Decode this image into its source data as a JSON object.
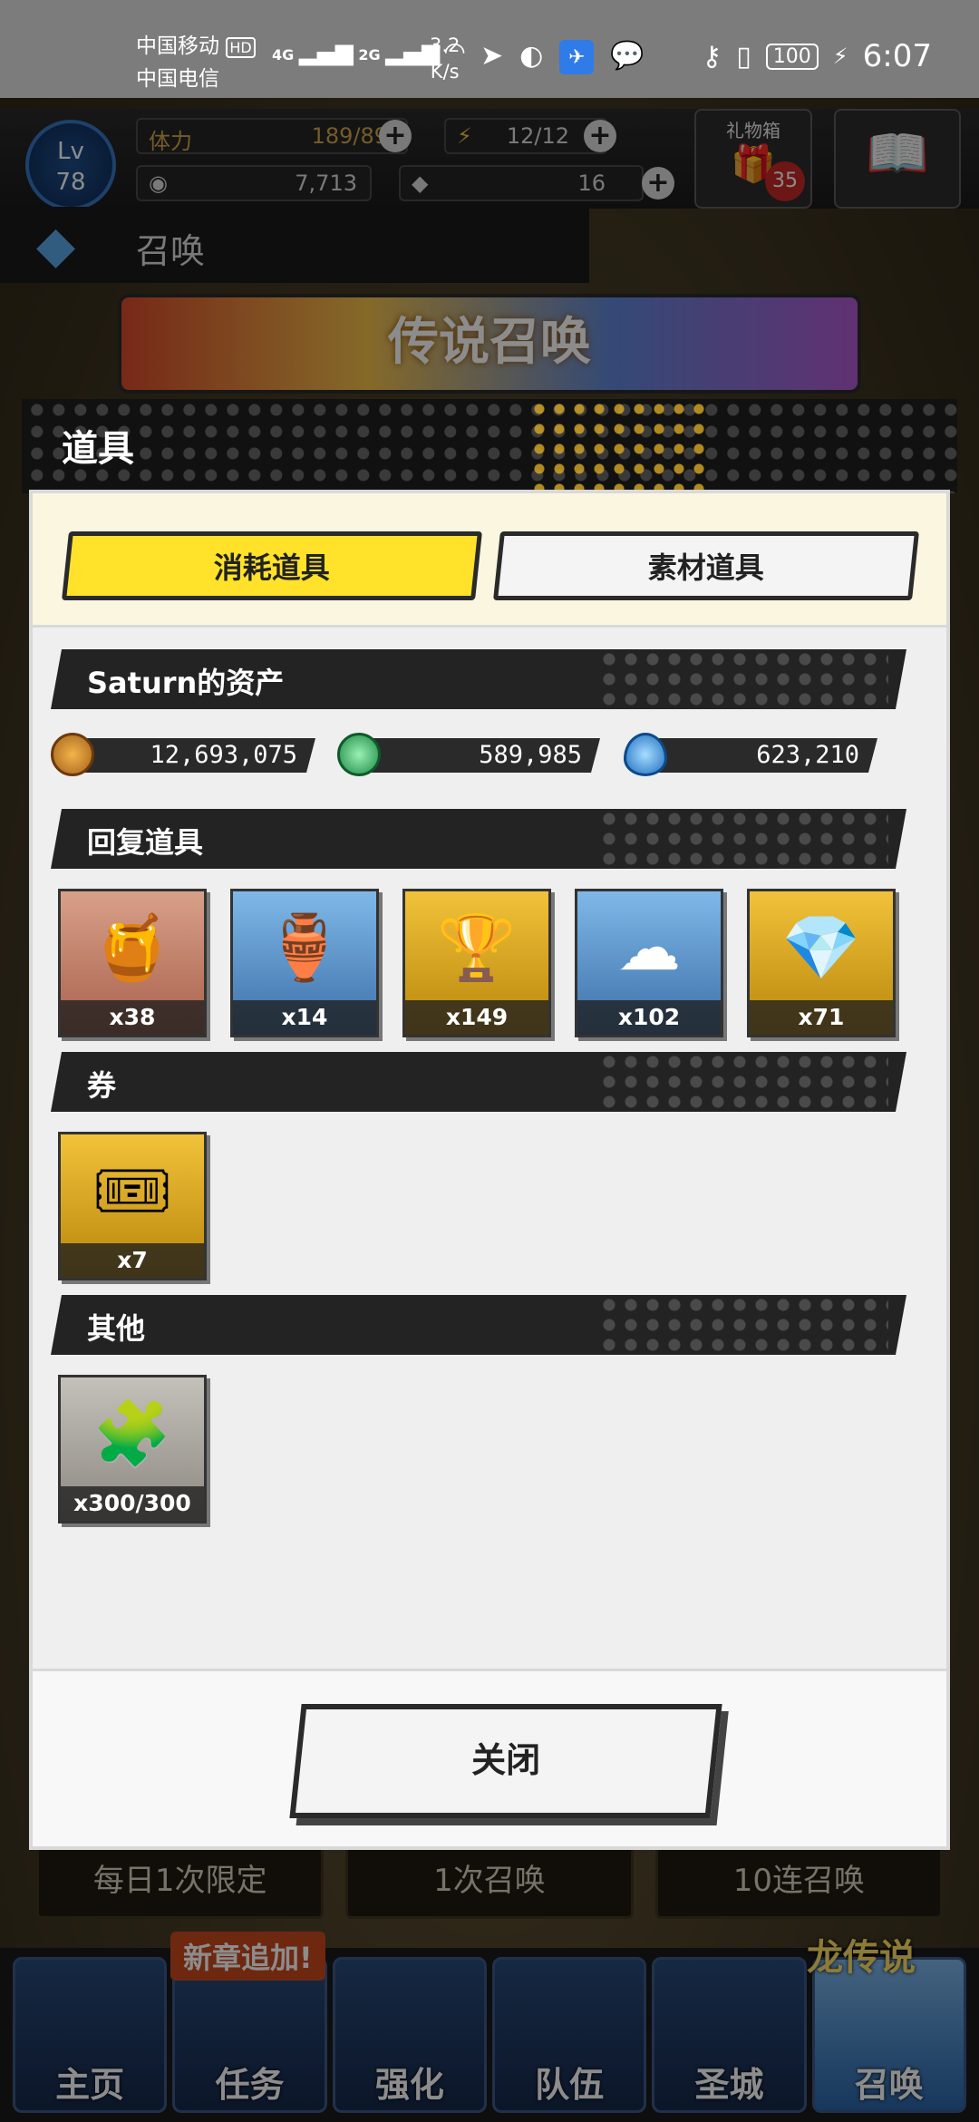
{
  "status_bar": {
    "carrier1": "中国移动",
    "carrier1_badge": "HD",
    "carrier2": "中国电信",
    "net1": "4G",
    "net2": "2G",
    "speed_value": "3.2",
    "speed_unit": "K/s",
    "battery": "100",
    "time": "6:07"
  },
  "game_bg": {
    "level_label": "Lv",
    "level": "78",
    "stamina_label": "体力",
    "stamina": "189/89",
    "energy": "12/12",
    "gems": "7,713",
    "crystals": "16",
    "gift_box_label": "礼物箱",
    "gift_count": "35",
    "summon_title": "召唤",
    "banner_title": "传说召唤",
    "bottom_tabs": [
      "每日1次限定",
      "1次召唤",
      "10连召唤"
    ],
    "new_chapter": "新章追加!",
    "dragon_legend": "龙传说",
    "nav": [
      "主页",
      "任务",
      "强化",
      "队伍",
      "圣城",
      "召唤"
    ]
  },
  "modal": {
    "title": "道具",
    "tabs": {
      "active": "消耗道具",
      "inactive": "素材道具"
    },
    "assets_header": "Saturn的资产",
    "currencies": [
      {
        "icon": "gold-coin-icon",
        "value": "12,693,075",
        "color": "#c87d1e"
      },
      {
        "icon": "green-orb-icon",
        "value": "589,985",
        "color": "#3cb86a"
      },
      {
        "icon": "water-drop-icon",
        "value": "623,210",
        "color": "#2f8fd8"
      }
    ],
    "recovery_header": "回复道具",
    "recovery_items": [
      {
        "icon": "potion-bottle-icon",
        "glyph": "🍯",
        "count": "x38"
      },
      {
        "icon": "honey-jar-icon",
        "glyph": "🏺",
        "count": "x14"
      },
      {
        "icon": "golden-pot-icon",
        "glyph": "🏆",
        "count": "x149"
      },
      {
        "icon": "cloud-carpet-icon",
        "glyph": "☁",
        "count": "x102"
      },
      {
        "icon": "treasure-urn-icon",
        "glyph": "💎",
        "count": "x71"
      }
    ],
    "ticket_header": "券",
    "ticket_items": [
      {
        "icon": "summon-ticket-icon",
        "glyph": "🎟",
        "count": "x7"
      }
    ],
    "other_header": "其他",
    "other_items": [
      {
        "icon": "puzzle-piece-icon",
        "glyph": "🧩",
        "count": "x300/300"
      }
    ],
    "close_label": "关闭"
  }
}
